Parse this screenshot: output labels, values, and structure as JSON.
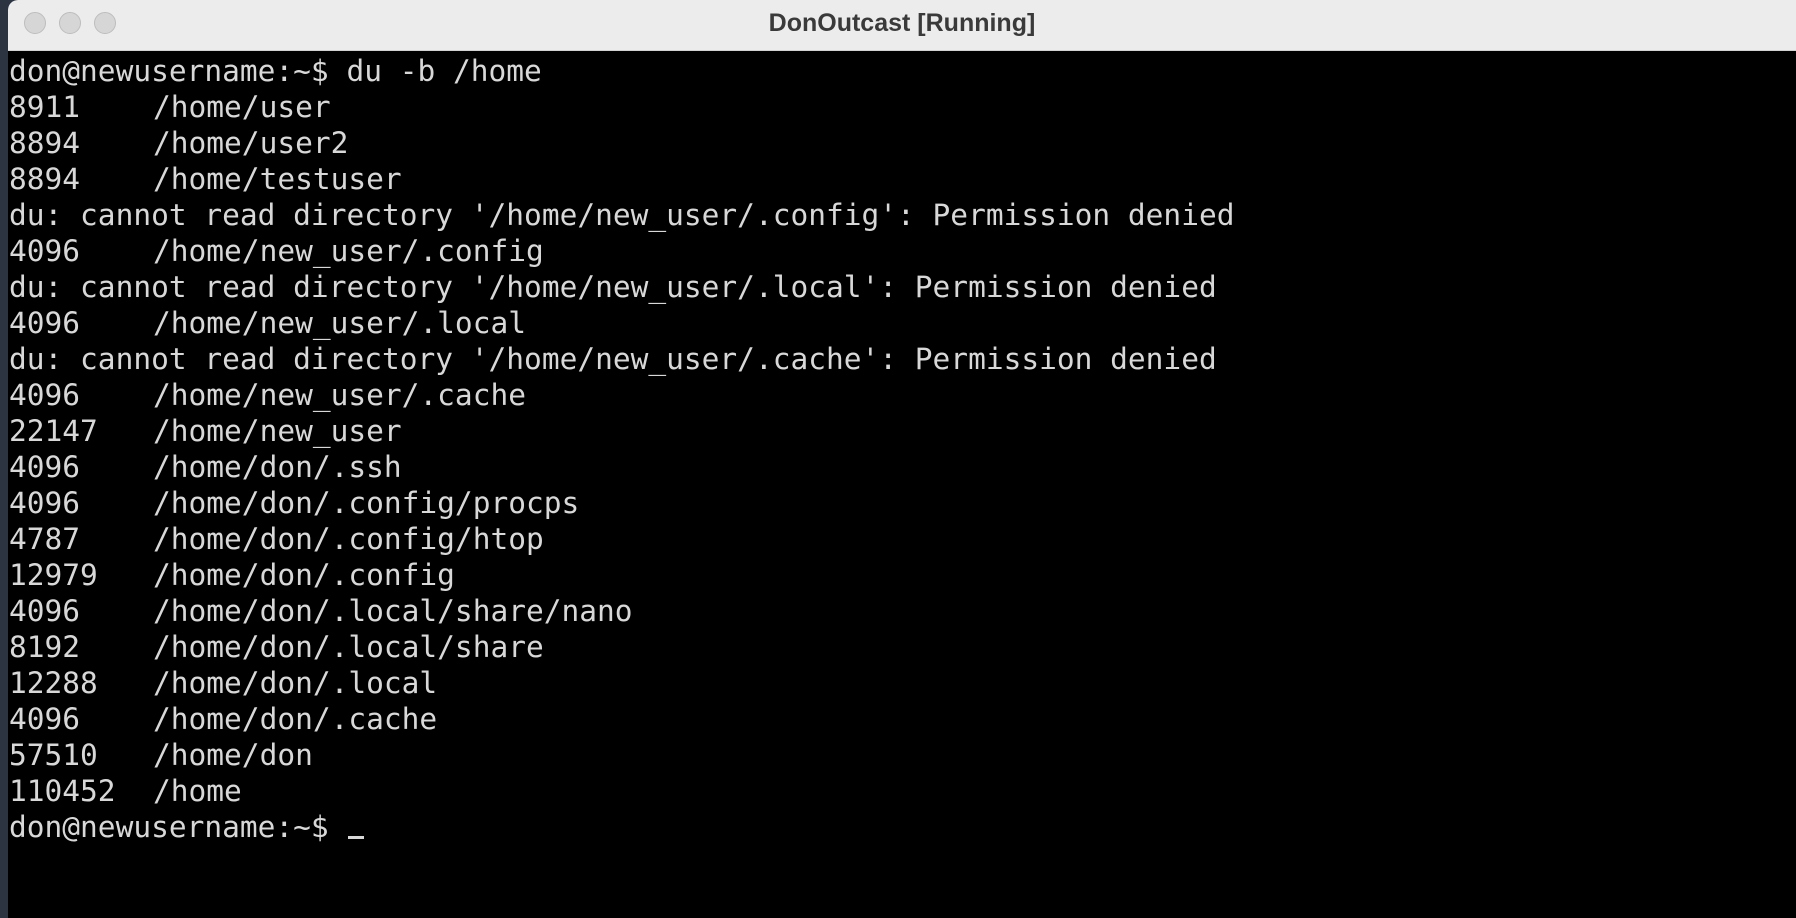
{
  "window": {
    "title": "DonOutcast [Running]"
  },
  "terminal": {
    "prompt": "don@newusername:~$ du -b /home",
    "output": [
      {
        "size": "8911",
        "path": "/home/user"
      },
      {
        "size": "8894",
        "path": "/home/user2"
      },
      {
        "size": "8894",
        "path": "/home/testuser"
      },
      {
        "text": "du: cannot read directory '/home/new_user/.config': Permission denied"
      },
      {
        "size": "4096",
        "path": "/home/new_user/.config"
      },
      {
        "text": "du: cannot read directory '/home/new_user/.local': Permission denied"
      },
      {
        "size": "4096",
        "path": "/home/new_user/.local"
      },
      {
        "text": "du: cannot read directory '/home/new_user/.cache': Permission denied"
      },
      {
        "size": "4096",
        "path": "/home/new_user/.cache"
      },
      {
        "size": "22147",
        "path": "/home/new_user"
      },
      {
        "size": "4096",
        "path": "/home/don/.ssh"
      },
      {
        "size": "4096",
        "path": "/home/don/.config/procps"
      },
      {
        "size": "4787",
        "path": "/home/don/.config/htop"
      },
      {
        "size": "12979",
        "path": "/home/don/.config"
      },
      {
        "size": "4096",
        "path": "/home/don/.local/share/nano"
      },
      {
        "size": "8192",
        "path": "/home/don/.local/share"
      },
      {
        "size": "12288",
        "path": "/home/don/.local"
      },
      {
        "size": "4096",
        "path": "/home/don/.cache"
      },
      {
        "size": "57510",
        "path": "/home/don"
      },
      {
        "size": "110452",
        "path": "/home"
      }
    ],
    "final_prompt": "don@newusername:~$ "
  }
}
